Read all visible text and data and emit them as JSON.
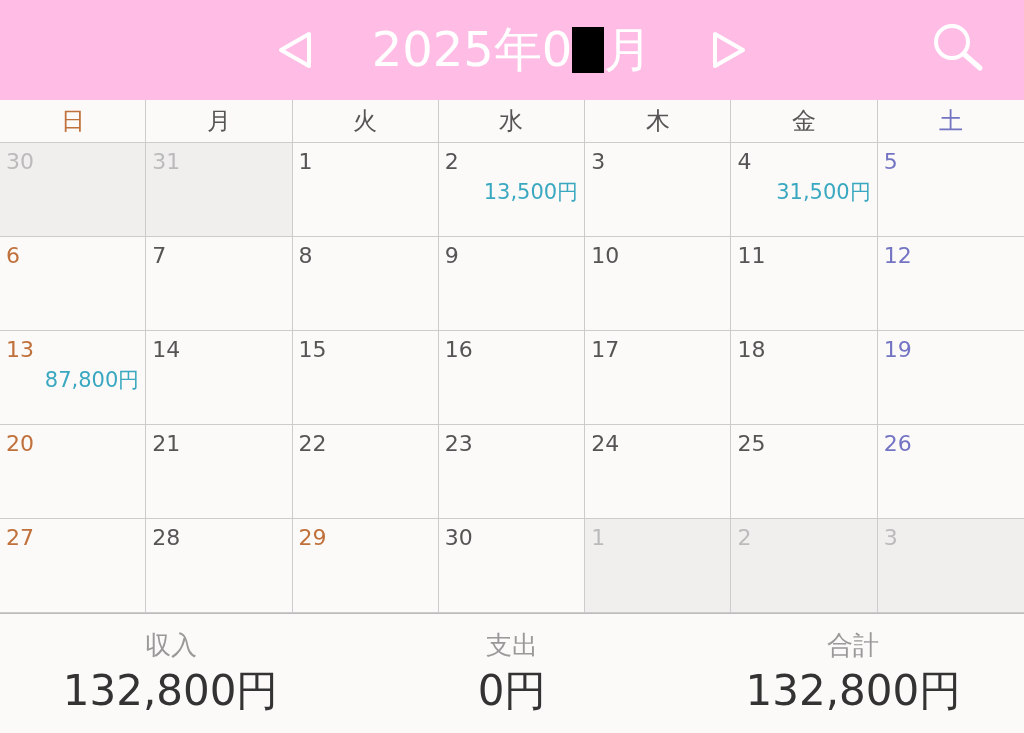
{
  "header": {
    "title_start": "2025年0",
    "title_end": "月"
  },
  "weekdays": [
    {
      "label": "日",
      "kind": "sunday"
    },
    {
      "label": "月",
      "kind": "weekday"
    },
    {
      "label": "火",
      "kind": "weekday"
    },
    {
      "label": "水",
      "kind": "weekday"
    },
    {
      "label": "木",
      "kind": "weekday"
    },
    {
      "label": "金",
      "kind": "weekday"
    },
    {
      "label": "土",
      "kind": "saturday"
    }
  ],
  "weeks": [
    [
      {
        "day": "30",
        "in_month": false
      },
      {
        "day": "31",
        "in_month": false
      },
      {
        "day": "1",
        "kind": "weekday",
        "in_month": true
      },
      {
        "day": "2",
        "kind": "weekday",
        "in_month": true,
        "amount": "13,500円"
      },
      {
        "day": "3",
        "kind": "weekday",
        "in_month": true
      },
      {
        "day": "4",
        "kind": "weekday",
        "in_month": true,
        "amount": "31,500円"
      },
      {
        "day": "5",
        "kind": "saturday",
        "in_month": true
      }
    ],
    [
      {
        "day": "6",
        "kind": "sunday",
        "in_month": true
      },
      {
        "day": "7",
        "kind": "weekday",
        "in_month": true
      },
      {
        "day": "8",
        "kind": "weekday",
        "in_month": true
      },
      {
        "day": "9",
        "kind": "weekday",
        "in_month": true
      },
      {
        "day": "10",
        "kind": "weekday",
        "in_month": true
      },
      {
        "day": "11",
        "kind": "weekday",
        "in_month": true
      },
      {
        "day": "12",
        "kind": "saturday",
        "in_month": true
      }
    ],
    [
      {
        "day": "13",
        "kind": "sunday",
        "in_month": true,
        "amount": "87,800円"
      },
      {
        "day": "14",
        "kind": "weekday",
        "in_month": true
      },
      {
        "day": "15",
        "kind": "weekday",
        "in_month": true
      },
      {
        "day": "16",
        "kind": "weekday",
        "in_month": true
      },
      {
        "day": "17",
        "kind": "weekday",
        "in_month": true
      },
      {
        "day": "18",
        "kind": "weekday",
        "in_month": true
      },
      {
        "day": "19",
        "kind": "saturday",
        "in_month": true
      }
    ],
    [
      {
        "day": "20",
        "kind": "sunday",
        "in_month": true
      },
      {
        "day": "21",
        "kind": "weekday",
        "in_month": true
      },
      {
        "day": "22",
        "kind": "weekday",
        "in_month": true
      },
      {
        "day": "23",
        "kind": "weekday",
        "in_month": true
      },
      {
        "day": "24",
        "kind": "weekday",
        "in_month": true
      },
      {
        "day": "25",
        "kind": "weekday",
        "in_month": true
      },
      {
        "day": "26",
        "kind": "saturday",
        "in_month": true
      }
    ],
    [
      {
        "day": "27",
        "kind": "sunday",
        "in_month": true
      },
      {
        "day": "28",
        "kind": "weekday",
        "in_month": true
      },
      {
        "day": "29",
        "kind": "holiday",
        "in_month": true
      },
      {
        "day": "30",
        "kind": "weekday",
        "in_month": true
      },
      {
        "day": "1",
        "in_month": false
      },
      {
        "day": "2",
        "in_month": false
      },
      {
        "day": "3",
        "in_month": false
      }
    ]
  ],
  "summary": [
    {
      "label": "収入",
      "value": "132,800円"
    },
    {
      "label": "支出",
      "value": "0円"
    },
    {
      "label": "合計",
      "value": "132,800円"
    }
  ]
}
